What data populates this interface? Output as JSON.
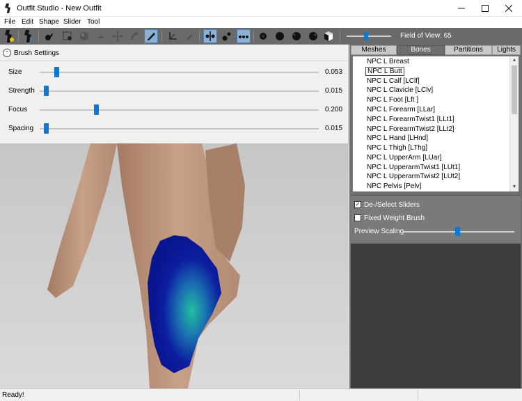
{
  "window": {
    "title": "Outfit Studio - New Outfit"
  },
  "menu": [
    "File",
    "Edit",
    "Shape",
    "Slider",
    "Tool"
  ],
  "toolbar": {
    "fov_label": "Field of View: 65",
    "fov_value": 65
  },
  "brush_settings": {
    "title": "Brush Settings",
    "sliders": [
      {
        "label": "Size",
        "value": "0.053",
        "fraction": 0.053
      },
      {
        "label": "Strength",
        "value": "0.015",
        "fraction": 0.015
      },
      {
        "label": "Focus",
        "value": "0.200",
        "fraction": 0.2
      },
      {
        "label": "Spacing",
        "value": "0.015",
        "fraction": 0.015
      }
    ]
  },
  "tabs": [
    {
      "label": "Meshes",
      "active": false
    },
    {
      "label": "Bones",
      "active": true
    },
    {
      "label": "Partitions",
      "active": false
    },
    {
      "label": "Lights",
      "active": false
    }
  ],
  "bones": [
    "NPC L Breast",
    "NPC L Butt",
    "NPC L Calf [LClf]",
    "NPC L Clavicle [LClv]",
    "NPC L Foot [Lft ]",
    "NPC L Forearm [LLar]",
    "NPC L ForearmTwist1 [LLt1]",
    "NPC L ForearmTwist2 [LLt2]",
    "NPC L Hand [LHnd]",
    "NPC L Thigh [LThg]",
    "NPC L UpperArm [LUar]",
    "NPC L UpperarmTwist1 [LUt1]",
    "NPC L UpperarmTwist2 [LUt2]",
    "NPC Pelvis [Pelv]"
  ],
  "selected_bone": "NPC L Butt",
  "options": {
    "deselect_sliders": "De-/Select Sliders",
    "deselect_checked": true,
    "fixed_weight_brush": "Fixed Weight Brush",
    "fixed_weight_checked": false,
    "preview_scaling": "Preview Scaling",
    "preview_scaling_fraction": 0.5
  },
  "status": {
    "text": "Ready!"
  },
  "colors": {
    "accent": "#0a78d4",
    "toolbar": "#6a6a6a",
    "weight_low": "#0a1a9a",
    "weight_high": "#1fb39a",
    "skin": "#c49a80"
  }
}
